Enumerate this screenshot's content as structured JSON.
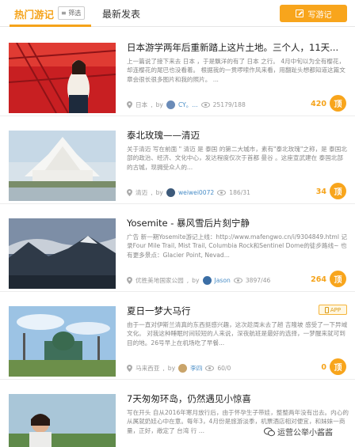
{
  "tabs": {
    "hot": "热门游记",
    "filter": "筛选",
    "latest": "最新发表"
  },
  "write_button": {
    "label": "写游记"
  },
  "items": [
    {
      "title": "日本游学两年后重新踏上这片土地。三个人，11天...",
      "desc": "上一篇说了接下来去 日本 ，于是飘洋的有了 日本 之行。 4月中旬以为全有樱花，却连樱花的尾巴也没看着。 根据我的一贯啰嗦作风来看，用翻趾头想都知道这篇文章会很长很多图片和我的照片。 ...",
      "location": "日本",
      "by": "by",
      "author": "CY。...",
      "views": "25179/188",
      "likes": "420",
      "ding": "顶"
    },
    {
      "title": "泰北玫瑰——清迈",
      "desc": "关于清迈 写在前面 \" 清迈 是 泰国 的第二大城市，素有\"泰北玫瑰\"之称，是 泰国北部的政治、经济、文化中心，发达程度仅次于首都 曼谷 。这座宣武建在 泰国北部 的古城，现拥受众人的...",
      "location": "清迈",
      "by": "by",
      "author": "weiwei0072",
      "views": "186/31",
      "likes": "34",
      "ding": "顶"
    },
    {
      "title": "Yosemite - 暴风雪后片刻宁静",
      "desc": "广告 新一期Yosemite游记上线：http://www.mafengwo.cn/i/9304849.html 记录Four Mile Trail, Mist Trail, Columbia Rock和Sentinel Dome的徒步路线~ 也有更多景点：Glacier Point, Nevad...",
      "location": "优胜美地国家公园",
      "by": "by",
      "author": "Jason",
      "views": "3897/46",
      "likes": "264",
      "ding": "顶"
    },
    {
      "title": "夏日一梦大马行",
      "badge": "APP",
      "desc": "由于一直对伊斯兰清真的东西挺感兴趣，这次趁周末去了趟 吉隆坡 感受了一下异域文化。 对我这种睡眠时间较短的人来说，深夜航班是最好的选择，一梦醒来就可到目的地。26号早上在机场吃了早餐...",
      "location": "马来西亚",
      "by": "by",
      "author": "李四",
      "views": "60/0",
      "likes": "0",
      "ding": "顶"
    },
    {
      "title": "7天匆匆环岛，仍然遇见小惊喜",
      "desc": "写在开头 自从2016年寒月放行后，由于怀孕生子带娃，整整两年没有出去。内心的从属就奶娃心中在意。每年3，4月份是旅游淡季，机票酒店相对便宜，和妹妹一商量，正好，敞定了 台湾 行 ...",
      "location": "",
      "by": "",
      "author": "",
      "views": "",
      "likes": "",
      "ding": ""
    }
  ],
  "watermark": "运营公举小酱酱",
  "colors": {
    "accent": "#f8a51c",
    "link": "#4a8ec7"
  },
  "icons": [
    "pencil-icon",
    "list-icon",
    "location-icon",
    "eye-icon",
    "wechat-icon"
  ]
}
